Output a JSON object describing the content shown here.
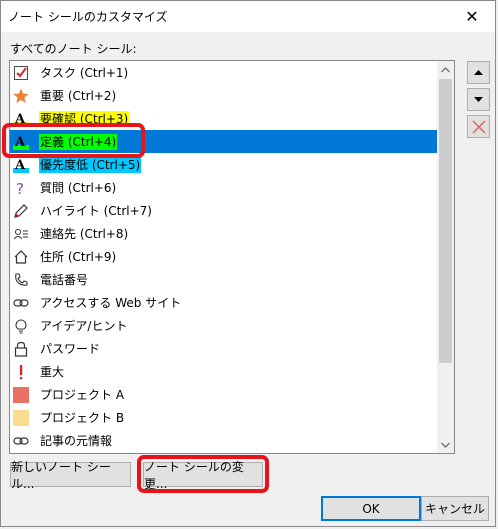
{
  "window": {
    "title": "ノート シールのカスタマイズ",
    "close_glyph": "✕"
  },
  "list": {
    "label": "すべてのノート シール:",
    "items": [
      {
        "label": "タスク (Ctrl+1)",
        "icon": "checkbox-icon"
      },
      {
        "label": "重要 (Ctrl+2)",
        "icon": "star-icon"
      },
      {
        "label": "要確認 (Ctrl+3)",
        "icon": "highlight-a-icon",
        "highlight": "#ffff00"
      },
      {
        "label": "定義 (Ctrl+4)",
        "icon": "highlight-a-icon",
        "highlight": "#00ff00",
        "selected": true
      },
      {
        "label": "優先度低 (Ctrl+5)",
        "icon": "highlight-a-icon",
        "highlight": "#00c8ff"
      },
      {
        "label": "質問 (Ctrl+6)",
        "icon": "question-icon"
      },
      {
        "label": "ハイライト (Ctrl+7)",
        "icon": "pen-icon"
      },
      {
        "label": "連絡先 (Ctrl+8)",
        "icon": "contact-icon"
      },
      {
        "label": "住所 (Ctrl+9)",
        "icon": "home-icon"
      },
      {
        "label": "電話番号",
        "icon": "phone-icon"
      },
      {
        "label": "アクセスする Web サイト",
        "icon": "link-icon"
      },
      {
        "label": "アイデア/ヒント",
        "icon": "lightbulb-icon"
      },
      {
        "label": "パスワード",
        "icon": "lock-icon"
      },
      {
        "label": "重大",
        "icon": "exclamation-icon"
      },
      {
        "label": "プロジェクト A",
        "icon": "square-red-icon"
      },
      {
        "label": "プロジェクト B",
        "icon": "square-yellow-icon"
      },
      {
        "label": "記事の元情報",
        "icon": "link-icon"
      }
    ]
  },
  "buttons": {
    "new_tag": "新しいノート シール...",
    "modify_tag": "ノート シールの変更...",
    "ok": "OK",
    "cancel": "キャンセル"
  },
  "colors": {
    "selection": "#0078d7",
    "callout_red": "#e8141b",
    "check_red": "#d9252b",
    "star_orange": "#e9833a",
    "project_a": "#e97062",
    "project_b": "#fbdb8e",
    "question_purple": "#8a4dbf"
  }
}
